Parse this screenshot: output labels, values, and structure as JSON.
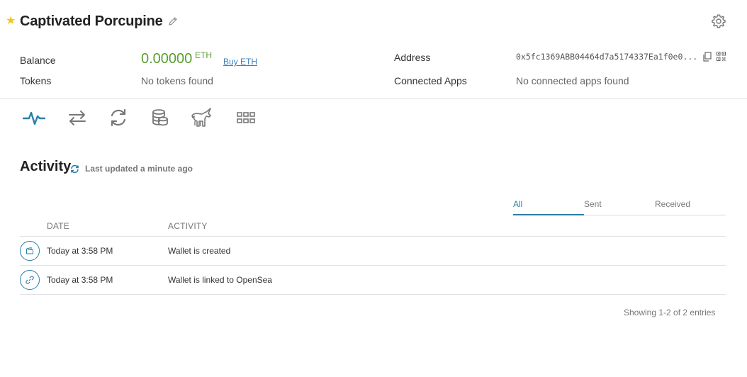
{
  "wallet": {
    "name": "Captivated Porcupine"
  },
  "info": {
    "balance_label": "Balance",
    "balance_value": "0.00000",
    "balance_unit": "ETH",
    "buy_label": "Buy ETH",
    "tokens_label": "Tokens",
    "tokens_value": "No tokens found",
    "address_label": "Address",
    "address_value": "0x5fc1369ABB04464d7a5174337Ea1f0e0...",
    "connected_label": "Connected Apps",
    "connected_value": "No connected apps found"
  },
  "toolbar": {
    "items": [
      "activity-icon",
      "transfer-icon",
      "swap-icon",
      "coins-icon",
      "opensea-unicorn-icon",
      "apps-grid-icon"
    ],
    "active_color": "#2c7fa8",
    "inactive_color": "#777777"
  },
  "activity": {
    "title": "Activity",
    "last_updated": "Last updated a minute ago",
    "tabs": [
      {
        "label": "All",
        "active": true
      },
      {
        "label": "Sent",
        "active": false
      },
      {
        "label": "Received",
        "active": false
      }
    ],
    "columns": {
      "date": "DATE",
      "activity": "ACTIVITY"
    },
    "rows": [
      {
        "icon": "wallet-icon",
        "date": "Today at 3:58 PM",
        "activity": "Wallet is created"
      },
      {
        "icon": "link-icon",
        "date": "Today at 3:58 PM",
        "activity": "Wallet is linked to OpenSea"
      }
    ],
    "entries_text": "Showing 1-2 of 2 entries"
  },
  "colors": {
    "accent": "#2c7fa8",
    "balance": "#5a9e2f",
    "star": "#f5c518",
    "link": "#3d7fbf"
  }
}
